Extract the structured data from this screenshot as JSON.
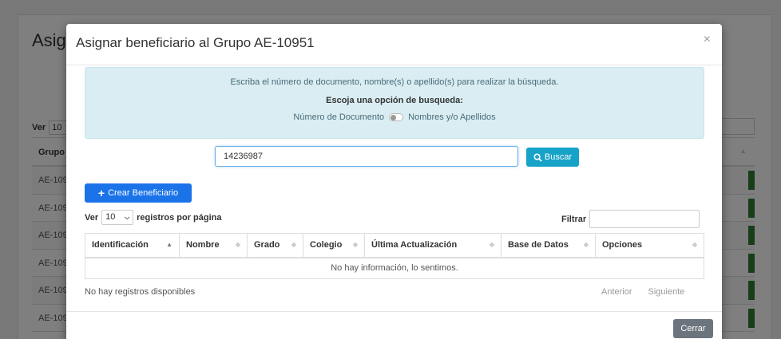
{
  "background": {
    "title": "Asig",
    "ver_label": "Ver",
    "ver_value": "10",
    "table_header": "Grupo",
    "rows": [
      "AE-109",
      "AE-109",
      "AE-109",
      "AE-109",
      "AE-109",
      "AE-109"
    ]
  },
  "modal": {
    "title": "Asignar beneficiario al Grupo AE-10951",
    "close_icon": "×",
    "info": {
      "instructions": "Escriba el número de documento, nombre(s) o apellido(s) para realizar la búsqueda.",
      "option_heading": "Escoja una opción de busqueda:",
      "option_left": "Número de Documento",
      "option_right": "Nombres y/o Apellidos"
    },
    "search": {
      "value": "14236987",
      "button_label": "Buscar"
    },
    "create_button_label": "Crear Beneficiario",
    "length": {
      "ver_label": "Ver",
      "value": "10",
      "suffix": "registros por página"
    },
    "filter_label": "Filtrar",
    "table": {
      "columns": [
        "Identificación",
        "Nombre",
        "Grado",
        "Colegio",
        "Última Actualización",
        "Base de Datos",
        "Opciones"
      ],
      "empty_message": "No hay información, lo sentimos."
    },
    "footer_info": "No hay registros disponibles",
    "pager": {
      "previous": "Anterior",
      "next": "Siguiente"
    },
    "close_button_label": "Cerrar"
  },
  "colors": {
    "info_bg": "#d9edf2",
    "search_button": "#17a2c8",
    "create_button": "#1a73e8",
    "close_button": "#6c757d"
  }
}
